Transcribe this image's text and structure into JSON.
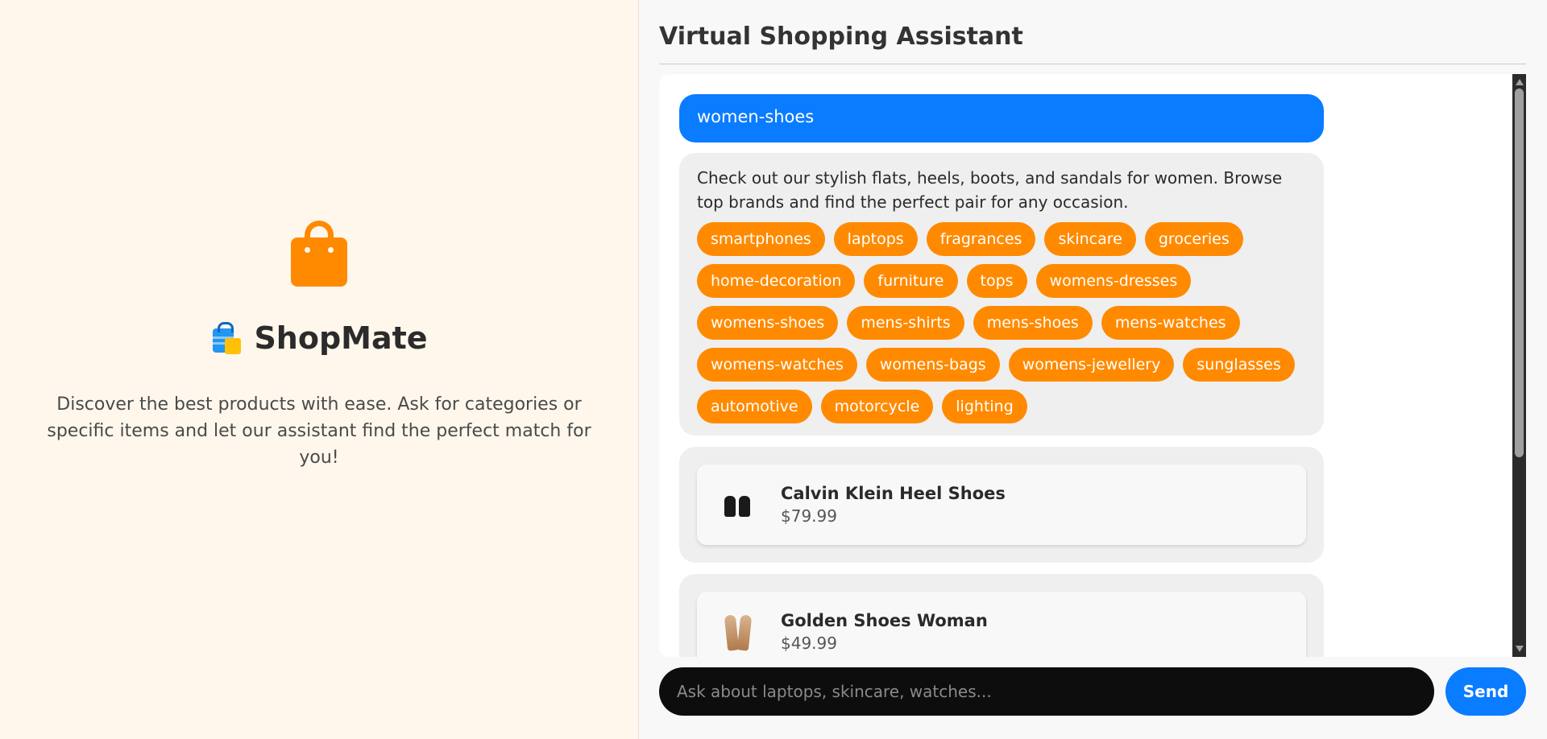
{
  "brand": {
    "icon": "shopping-bag-icon",
    "emoji": "shopping-bags-emoji",
    "title": "ShopMate",
    "tagline": "Discover the best products with ease. Ask for categories or specific items and let our assistant find the perfect match for you!"
  },
  "assistant": {
    "title": "Virtual Shopping Assistant",
    "user_message": "women-shoes",
    "bot_message": "Check out our stylish flats, heels, boots, and sandals for women. Browse top brands and find the perfect pair for any occasion.",
    "categories": [
      "smartphones",
      "laptops",
      "fragrances",
      "skincare",
      "groceries",
      "home-decoration",
      "furniture",
      "tops",
      "womens-dresses",
      "womens-shoes",
      "mens-shirts",
      "mens-shoes",
      "mens-watches",
      "womens-watches",
      "womens-bags",
      "womens-jewellery",
      "sunglasses",
      "automotive",
      "motorcycle",
      "lighting"
    ],
    "products": [
      {
        "name": "Calvin Klein Heel Shoes",
        "price": "$79.99",
        "image": "black-heel-shoes"
      },
      {
        "name": "Golden Shoes Woman",
        "price": "$49.99",
        "image": "golden-heel-shoes"
      }
    ]
  },
  "input": {
    "placeholder": "Ask about laptops, skincare, watches...",
    "value": "",
    "send_label": "Send"
  },
  "colors": {
    "accent_orange": "#ff8a00",
    "accent_blue": "#0a7cff",
    "left_bg": "#fff7ec"
  }
}
